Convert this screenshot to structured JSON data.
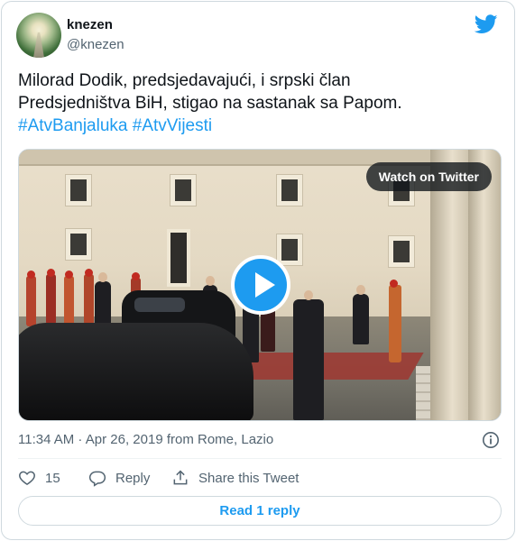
{
  "author": {
    "name": "knezen",
    "handle": "@knezen"
  },
  "tweet": {
    "text_line1": "Milorad Dodik, predsjedavajući, i srpski član",
    "text_line2": "Predsjedništva BiH, stigao na sastanak sa Papom.",
    "hashtag1": "#AtvBanjaluka",
    "hashtag2": "#AtvVijesti"
  },
  "media": {
    "watch_label": "Watch on Twitter"
  },
  "meta": {
    "timestamp": "11:34 AM · Apr 26, 2019 from Rome, Lazio"
  },
  "actions": {
    "like_count": "15",
    "reply_label": "Reply",
    "share_label": "Share this Tweet"
  },
  "footer": {
    "read_replies_label": "Read 1 reply"
  },
  "colors": {
    "accent": "#1d9bf0",
    "text": "#0f1419",
    "muted": "#536471",
    "border": "#cfd9de"
  },
  "icons": [
    "twitter-bird-icon",
    "play-icon",
    "info-icon",
    "heart-icon",
    "reply-icon",
    "share-icon"
  ]
}
